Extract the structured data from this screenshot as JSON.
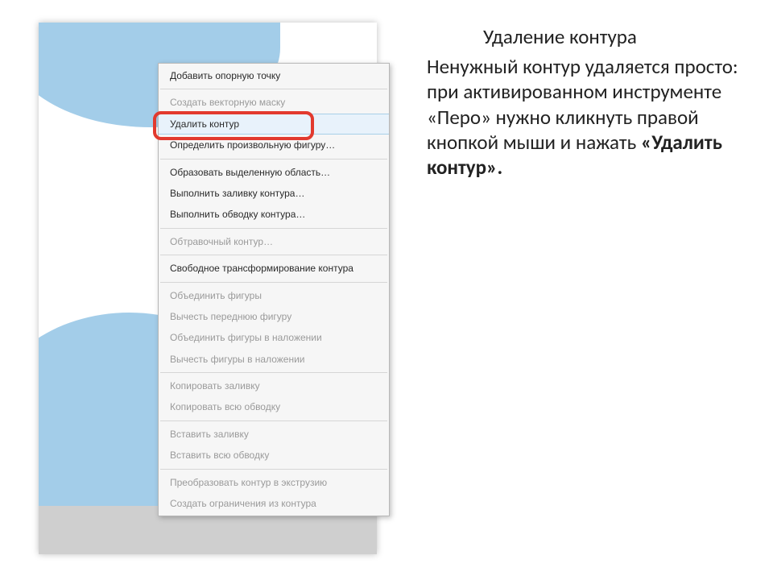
{
  "menu": {
    "add_anchor": "Добавить опорную точку",
    "create_vector_mask": "Создать векторную маску",
    "delete_path": "Удалить контур",
    "define_custom_shape": "Определить произвольную фигуру…",
    "make_selection": "Образовать выделенную область…",
    "fill_path": "Выполнить заливку контура…",
    "stroke_path": "Выполнить обводку контура…",
    "clipping_path": "Обтравочный контур…",
    "free_transform": "Свободное трансформирование контура",
    "unite_shapes": "Объединить фигуры",
    "subtract_front": "Вычесть переднюю фигуру",
    "unite_overlap": "Объединить фигуры в наложении",
    "subtract_overlap": "Вычесть фигуры в наложении",
    "copy_fill": "Копировать заливку",
    "copy_stroke": "Копировать всю обводку",
    "paste_fill": "Вставить заливку",
    "paste_stroke": "Вставить всю обводку",
    "to_extrusion": "Преобразовать контур в экструзию",
    "constraints": "Создать ограничения из контура"
  },
  "article": {
    "title": "Удаление контура",
    "para_lead": "Ненужный контур удаляется просто: при активированном инструменте «Перо» нужно кликнуть правой кнопкой мыши и нажать ",
    "para_bold": "«Удалить контур»."
  }
}
